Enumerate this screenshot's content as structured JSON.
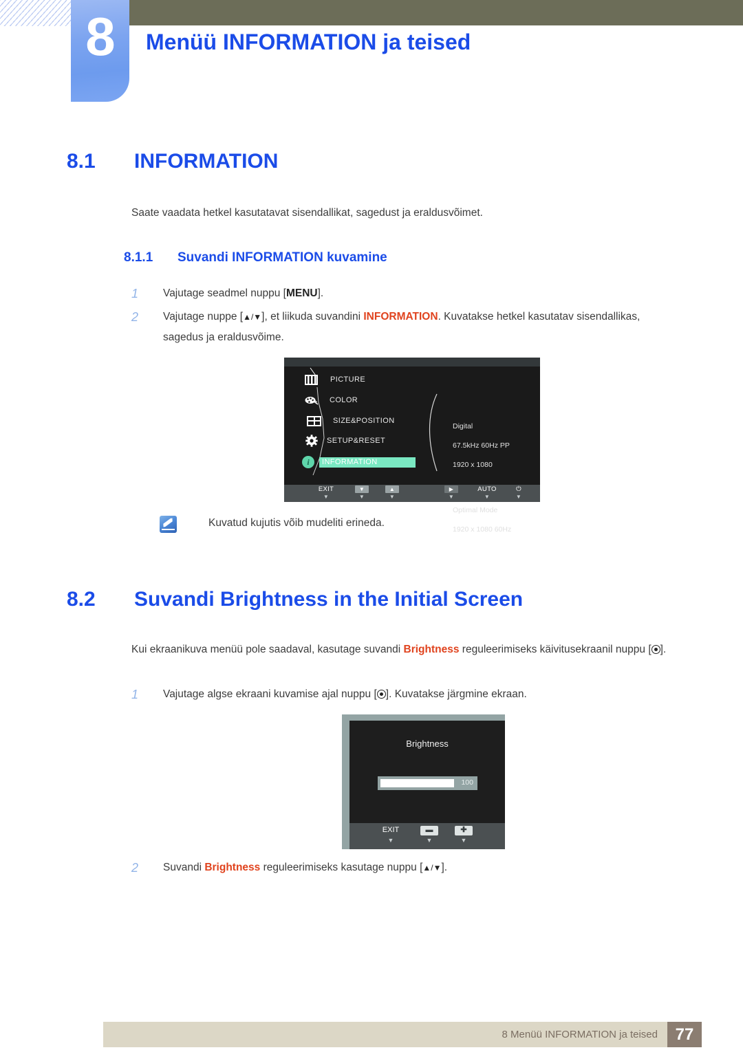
{
  "header": {
    "chapter_number": "8",
    "chapter_title": "Menüü INFORMATION ja teised"
  },
  "sections": {
    "s81": {
      "number": "8.1",
      "title": "INFORMATION",
      "intro": "Saate vaadata hetkel kasutatavat sisendallikat, sagedust ja eraldusvõimet.",
      "sub": {
        "number": "8.1.1",
        "title": "Suvandi INFORMATION kuvamine",
        "steps": [
          {
            "num": "1",
            "before": "Vajutage seadmel nuppu [",
            "bold": "MENU",
            "after": "]."
          },
          {
            "num": "2",
            "before": "Vajutage nuppe [",
            "arrows": "▲/▼",
            "mid": "], et liikuda suvandini ",
            "keyword": "INFORMATION",
            "after": ". Kuvatakse hetkel kasutatav sisendallikas, sagedus ja eraldusvõime."
          }
        ]
      },
      "note": {
        "icon": "note-icon",
        "text": "Kuvatud kujutis võib mudeliti erineda."
      }
    },
    "s82": {
      "number": "8.2",
      "title": "Suvandi Brightness in the Initial Screen",
      "intro": {
        "before": "Kui ekraanikuva menüü pole saadaval, kasutage suvandi ",
        "keyword": "Brightness",
        "mid": " reguleerimiseks käivitusekraanil nuppu [",
        "after": "]."
      },
      "steps": [
        {
          "num": "1",
          "before": "Vajutage algse ekraani kuvamise ajal nuppu [",
          "after": "]. Kuvatakse järgmine ekraan."
        },
        {
          "num": "2",
          "before": "Suvandi ",
          "keyword": "Brightness",
          "mid": " reguleerimiseks kasutage nuppu [",
          "arrows": "▲/▼",
          "after": "]."
        }
      ]
    }
  },
  "osd_main": {
    "menu_items": [
      {
        "icon": "picture-icon",
        "label": "PICTURE",
        "selected": false
      },
      {
        "icon": "color-palette-icon",
        "label": "COLOR",
        "selected": false
      },
      {
        "icon": "size-position-icon",
        "label": "SIZE&POSITION",
        "selected": false
      },
      {
        "icon": "gear-icon",
        "label": "SETUP&RESET",
        "selected": false
      },
      {
        "icon": "information-icon",
        "label": "INFORMATION",
        "selected": true
      }
    ],
    "info_panel": {
      "source": "Digital",
      "frequency": "67.5kHz 60Hz PP",
      "resolution": "1920 x 1080",
      "optimal_label": "Optimal Mode",
      "optimal_resolution": "1920 x 1080 60Hz"
    },
    "buttons": [
      {
        "label": "EXIT",
        "glyph": "",
        "type": "text"
      },
      {
        "label": "",
        "glyph": "▼",
        "type": "keycap"
      },
      {
        "label": "",
        "glyph": "▲",
        "type": "keycap"
      },
      {
        "label": "",
        "glyph": "▶",
        "type": "keycap-dim"
      },
      {
        "label": "AUTO",
        "glyph": "",
        "type": "text"
      },
      {
        "label": "",
        "glyph": "⏻",
        "type": "text"
      }
    ],
    "colors": {
      "background": "#1a1a1a",
      "highlight": "#7ae8c2",
      "info_icon": "#5fd6ab",
      "bottom_bar": "#4b5052"
    }
  },
  "osd_brightness": {
    "title": "Brightness",
    "value": "100",
    "fill_percent": 100,
    "buttons": [
      {
        "label": "EXIT",
        "glyph": "",
        "type": "text"
      },
      {
        "label": "",
        "glyph": "▬",
        "type": "keycap"
      },
      {
        "label": "",
        "glyph": "✚",
        "type": "keycap"
      }
    ],
    "colors": {
      "frame": "#93a4a4",
      "background": "#1e1e1e",
      "bottom_bar": "#4b5052"
    }
  },
  "footer": {
    "text": "8 Menüü INFORMATION ja teised",
    "page": "77",
    "colors": {
      "bar": "#dcd7c6",
      "page_box": "#8b7d71"
    }
  }
}
